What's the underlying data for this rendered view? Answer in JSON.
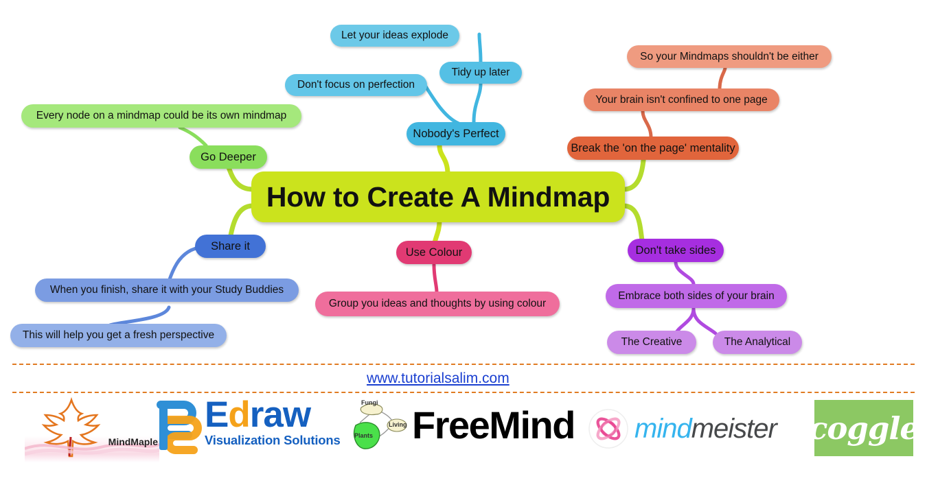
{
  "mindmap": {
    "central": {
      "label": "How to Create A Mindmap",
      "color": "#cbe31d"
    },
    "branches": [
      {
        "id": "nobodys-perfect",
        "label": "Nobody's Perfect",
        "color": "#41b6e0",
        "children": [
          {
            "label": "Let your ideas explode",
            "color": "#6cc9e8"
          },
          {
            "label": "Tidy up later",
            "color": "#55c0e5"
          },
          {
            "label": "Don't focus on perfection",
            "color": "#63c6e8"
          }
        ]
      },
      {
        "id": "break-on-the-page",
        "label": "Break the 'on the page' mentality",
        "color": "#e1653c",
        "children": [
          {
            "label": "Your brain isn't confined to one page",
            "color": "#e98466"
          },
          {
            "label": "So your Mindmaps shouldn't be either",
            "color": "#ef9b80"
          }
        ]
      },
      {
        "id": "go-deeper",
        "label": "Go Deeper",
        "color": "#8ade5c",
        "children": [
          {
            "label": "Every node on a mindmap could be its own mindmap",
            "color": "#a5e87c"
          }
        ]
      },
      {
        "id": "share-it",
        "label": "Share it",
        "color": "#4272d6",
        "children": [
          {
            "label": "When you finish, share it with your Study Buddies",
            "color": "#7b9ce2"
          },
          {
            "label": "This will help you get a fresh perspective",
            "color": "#93b0e8"
          }
        ]
      },
      {
        "id": "use-colour",
        "label": "Use Colour",
        "color": "#e13a73",
        "children": [
          {
            "label": "Group you ideas and thoughts by using colour",
            "color": "#ef6e9c"
          }
        ]
      },
      {
        "id": "dont-take-sides",
        "label": "Don't take sides",
        "color": "#a62ee0",
        "children": [
          {
            "label": "Embrace both sides of your brain",
            "color": "#c06ae8"
          },
          {
            "label": "The Creative",
            "color": "#cb8ae8"
          },
          {
            "label": "The Analytical",
            "color": "#cb8ae8"
          }
        ]
      }
    ]
  },
  "footer": {
    "site_url": "www.tutorialsalim.com",
    "divider_color": "#e07b22",
    "logos": [
      {
        "id": "mindmaple",
        "name": "MindMaple",
        "wordmark": "MindMaple"
      },
      {
        "id": "edraw",
        "name": "Edraw",
        "wordmark_part1": "E",
        "wordmark_part2": "d",
        "wordmark_part3": "raw",
        "tagline": "Visualization Solutions"
      },
      {
        "id": "freemind",
        "name": "FreeMind",
        "wordmark": "FreeMind"
      },
      {
        "id": "mindmeister",
        "name": "MindMeister",
        "wordmark_part1": "mind",
        "wordmark_part2": "meister"
      },
      {
        "id": "coggle",
        "name": "Coggle",
        "wordmark": "coggle"
      }
    ],
    "mini_map_labels": {
      "top": "Fungi",
      "right": "Living",
      "bottom": "Plants"
    }
  }
}
